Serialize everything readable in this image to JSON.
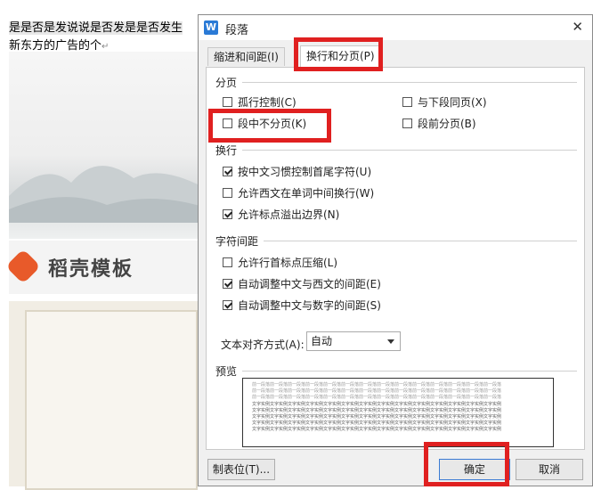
{
  "document": {
    "line1": "是是否是发说说是否发是是否发生",
    "line2": "新东方的广告的个",
    "paragraph_mark": "↵",
    "logo_text": "稻壳模板"
  },
  "dialog": {
    "icon_letter": "W",
    "title": "段落",
    "close_glyph": "✕",
    "tabs": [
      {
        "label": "缩进和间距(I)",
        "active": false
      },
      {
        "label": "换行和分页(P)",
        "active": true
      }
    ],
    "sections": {
      "pagination": {
        "title": "分页",
        "options": [
          {
            "label": "孤行控制(C)",
            "checked": false
          },
          {
            "label": "与下段同页(X)",
            "checked": false
          },
          {
            "label": "段中不分页(K)",
            "checked": false
          },
          {
            "label": "段前分页(B)",
            "checked": false
          }
        ]
      },
      "line_break": {
        "title": "换行",
        "options": [
          {
            "label": "按中文习惯控制首尾字符(U)",
            "checked": true
          },
          {
            "label": "允许西文在单词中间换行(W)",
            "checked": false
          },
          {
            "label": "允许标点溢出边界(N)",
            "checked": true
          }
        ]
      },
      "char_spacing": {
        "title": "字符间距",
        "options": [
          {
            "label": "允许行首标点压缩(L)",
            "checked": false
          },
          {
            "label": "自动调整中文与西文的间距(E)",
            "checked": true
          },
          {
            "label": "自动调整中文与数字的间距(S)",
            "checked": true
          }
        ]
      }
    },
    "text_align": {
      "label": "文本对齐方式(A):",
      "value": "自动"
    },
    "preview": {
      "title": "预览",
      "prev_para": "前一段落前一段落前一段落前一段落前一段落前一段落前一段落前一段落前一段落前一段落前一段落前一段落前一段落前一段落",
      "sample": "文字实例文字实例文字实例文字实例文字实例文字实例文字实例文字实例文字实例文字实例文字实例文字实例文字实例文字实例"
    },
    "buttons": {
      "tabs": "制表位(T)...",
      "ok": "确定",
      "cancel": "取消"
    }
  },
  "highlight_color": "#e02020"
}
